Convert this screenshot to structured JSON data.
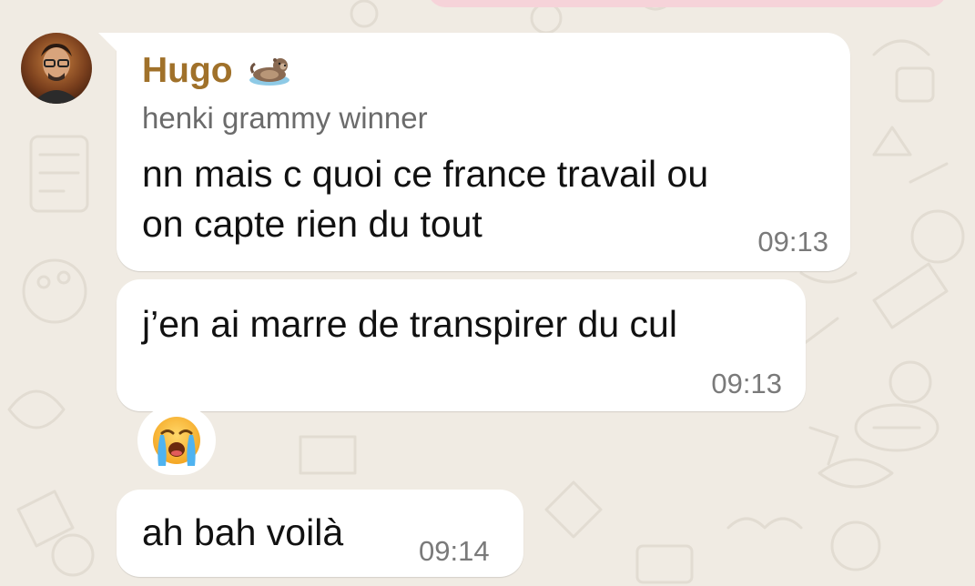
{
  "chat": {
    "sender_name": "Hugo",
    "sender_emoji": "otter-emoji",
    "sender_subtitle": "henki grammy winner",
    "messages": [
      {
        "lines": [
          "nn mais c quoi ce france travail ou",
          "on capte rien du tout"
        ],
        "time": "09:13"
      },
      {
        "lines": [
          "j’en ai marre de transpirer du cul"
        ],
        "time": "09:13"
      },
      {
        "reaction_emoji": "loudly-crying-face-emoji"
      },
      {
        "lines": [
          "ah bah voilà"
        ],
        "time": "09:14"
      }
    ]
  },
  "colors": {
    "background": "#f0ebe3",
    "bubble": "#ffffff",
    "sender_name": "#a0712a",
    "subtitle": "#6b6b6b",
    "message_text": "#111111",
    "timestamp": "#7a7a7a",
    "pink_bubble": "#f6d3d9"
  }
}
